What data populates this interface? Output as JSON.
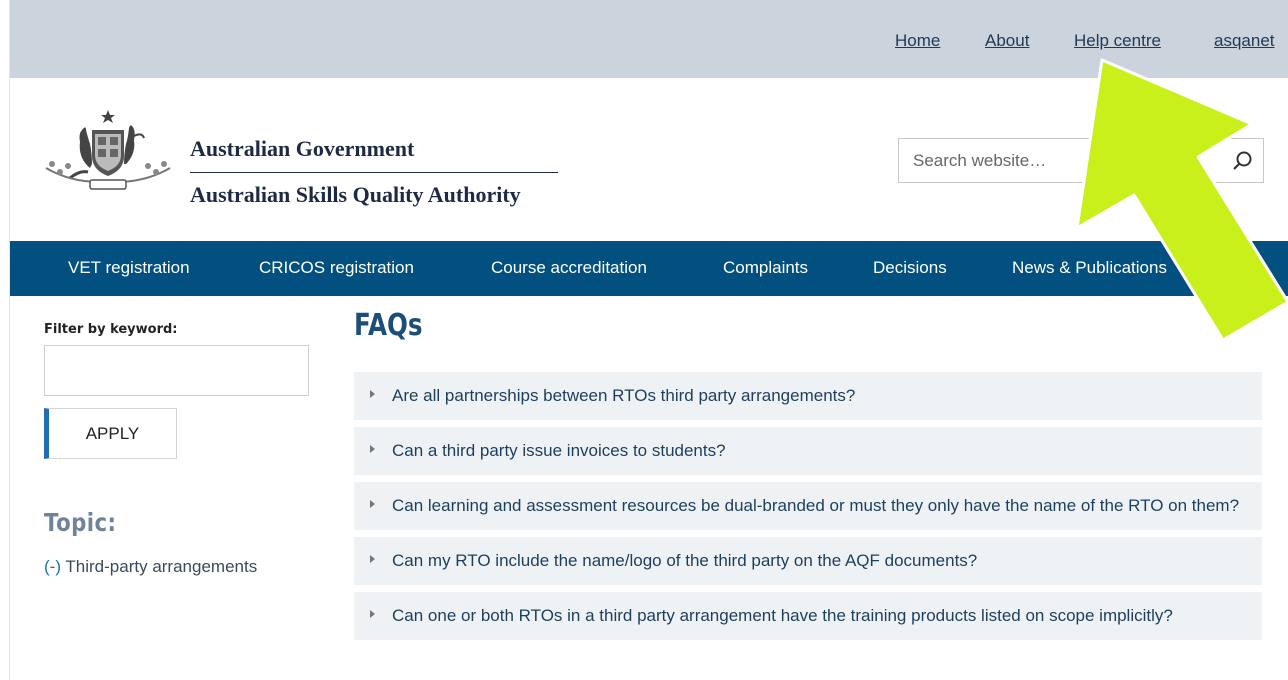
{
  "utility_nav": {
    "home": "Home",
    "about": "About",
    "help_centre": "Help centre",
    "asqanet": "asqanet"
  },
  "header": {
    "government": "Australian Government",
    "agency": "Australian Skills Quality Authority",
    "crest_icon": "commonwealth-coat-of-arms",
    "search_placeholder": "Search website…",
    "search_icon": "search-icon"
  },
  "main_nav": {
    "items": [
      "VET registration",
      "CRICOS registration",
      "Course accreditation",
      "Complaints",
      "Decisions",
      "News & Publications"
    ]
  },
  "sidebar": {
    "filter_label": "Filter by keyword:",
    "filter_value": "",
    "apply_label": "APPLY",
    "topic_heading": "Topic:",
    "topic_remove": "(-)",
    "topic_name": "Third-party arrangements"
  },
  "content": {
    "title": "FAQs",
    "faqs": [
      "Are all partnerships between RTOs third party arrangements?",
      "Can a third party issue invoices to students?",
      "Can learning and assessment resources be dual-branded or must they only have the name of the RTO on them?",
      "Can my RTO include the name/logo of the third party on the AQF documents?",
      "Can one or both RTOs in a third party arrangement have the training products listed on scope implicitly?"
    ]
  },
  "colors": {
    "utility_bar": "#cbd3dc",
    "nav_bar": "#01507f",
    "faq_bg": "#eef2f5",
    "annotation_arrow": "#c9f01a"
  }
}
